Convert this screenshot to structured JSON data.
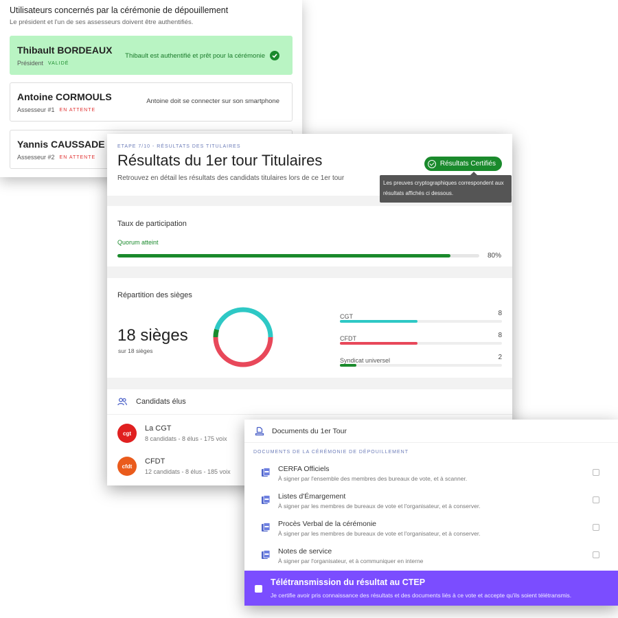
{
  "auth": {
    "title": "Utilisateurs concernés par la cérémonie de dépouillement",
    "subtitle": "Le président et l'un de ses assesseurs doivent être authentifiés.",
    "users": [
      {
        "name": "Thibault BORDEAUX",
        "role": "Président",
        "status": "VALIDÉ",
        "message": "Thibault est authentifié et prêt pour la cérémonie"
      },
      {
        "name": "Antoine CORMOULS",
        "role": "Assesseur #1",
        "status": "EN ATTENTE",
        "message": "Antoine doit se connecter sur son smartphone"
      },
      {
        "name": "Yannis CAUSSADE",
        "role": "Assesseur #2",
        "status": "EN ATTENTE"
      }
    ]
  },
  "results": {
    "step": "ETAPE 7/10 - RÉSULTATS DES TITULAIRES",
    "title": "Résultats du 1er tour Titulaires",
    "subtitle": "Retrouvez en détail les résultats des candidats titulaires lors de ce 1er tour",
    "certified_label": "Résultats Certifiés",
    "tooltip": "Les preuves cryptographiques correspondent aux résultats affichés ci dessous.",
    "participation": {
      "title": "Taux de participation",
      "quorum": "Quorum atteint",
      "value_label": "80%",
      "fill_percent": 92
    },
    "seats": {
      "title": "Répartition des sièges",
      "total": "18 sièges",
      "sub": "sur 18 sièges",
      "items": [
        {
          "name": "CGT",
          "value": "8",
          "fill_percent": 48,
          "color": "#2ec8c5"
        },
        {
          "name": "CFDT",
          "value": "8",
          "fill_percent": 48,
          "color": "#e8485a"
        },
        {
          "name": "Syndicat universel",
          "value": "2",
          "fill_percent": 10,
          "color": "#1a8a2c"
        }
      ]
    },
    "elected": {
      "title": "Candidats élus",
      "candidates": [
        {
          "name": "La CGT",
          "detail": "8 candidats - 8 élus - 175 voix",
          "logo": "cgt",
          "color": "#e02020"
        },
        {
          "name": "CFDT",
          "detail": "12 candidats - 8 élus - 185 voix",
          "logo": "cfdt",
          "color": "#ea5b1c"
        }
      ]
    }
  },
  "documents": {
    "title": "Documents du 1er Tour",
    "section": "DOCUMENTS DE LA CÉRÉMONIE DE DÉPOUILLEMENT",
    "items": [
      {
        "name": "CERFA Officiels",
        "desc": "À signer par l'ensemble des membres des bureaux de vote, et à scanner."
      },
      {
        "name": "Listes d'Émargement",
        "desc": "À signer par les membres de bureaux de vote et l'organisateur, et à conserver."
      },
      {
        "name": "Procès Verbal de la cérémonie",
        "desc": "À signer par les membres de bureaux de vote et l'organisateur, et à conserver."
      },
      {
        "name": "Notes de service",
        "desc": "À signer par l'organisateur, et à communiquer en interne"
      }
    ],
    "ctep": {
      "title": "Télétransmission du résultat au CTEP",
      "desc": "Je certifie avoir pris connaissance des résultats et des documents liés à ce vote et accepte qu'ils soient télétransmis."
    }
  },
  "colors": {
    "accent_green": "#1a8a2c",
    "accent_purple": "#7b4dff",
    "light_green": "#b9f4c3"
  }
}
